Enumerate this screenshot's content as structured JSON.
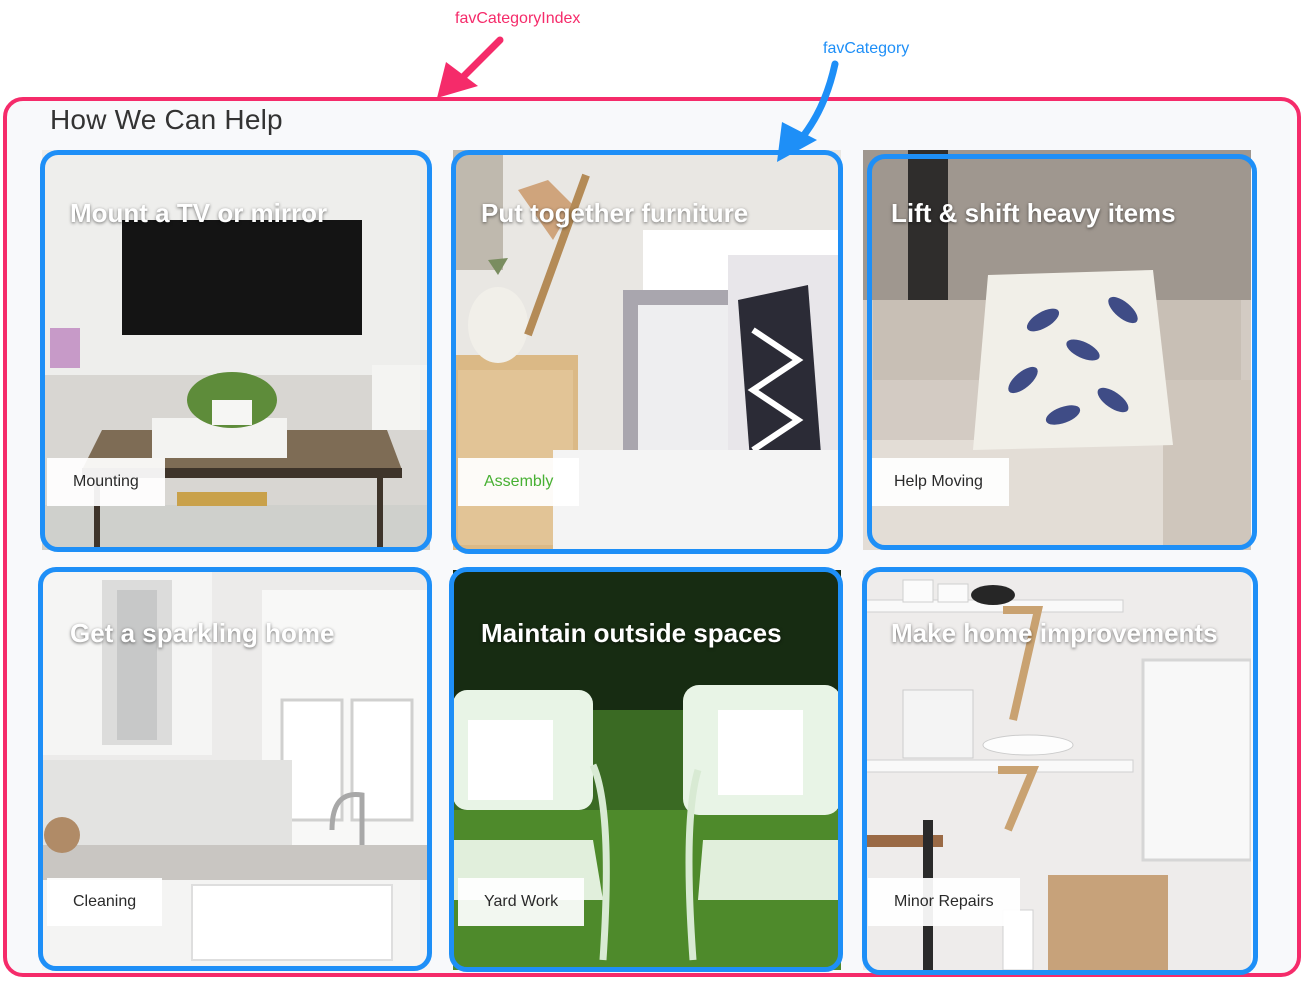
{
  "annotations": {
    "outer_label": "favCategoryIndex",
    "card_label": "favCategory",
    "outer_color": "#f52b6a",
    "card_color": "#1e8ff7"
  },
  "section": {
    "title": "How We Can Help"
  },
  "categories": [
    {
      "title": "Mount a TV or mirror",
      "tag": "Mounting",
      "selected": false
    },
    {
      "title": "Put together furniture",
      "tag": "Assembly",
      "selected": true
    },
    {
      "title": "Lift & shift heavy items",
      "tag": "Help Moving",
      "selected": false
    },
    {
      "title": "Get a sparkling home",
      "tag": "Cleaning",
      "selected": false
    },
    {
      "title": "Maintain outside spaces",
      "tag": "Yard Work",
      "selected": false
    },
    {
      "title": "Make home improvements",
      "tag": "Minor Repairs",
      "selected": false
    }
  ],
  "colors": {
    "selected_tag": "#47b033",
    "tag_text": "#2a2a2a"
  }
}
